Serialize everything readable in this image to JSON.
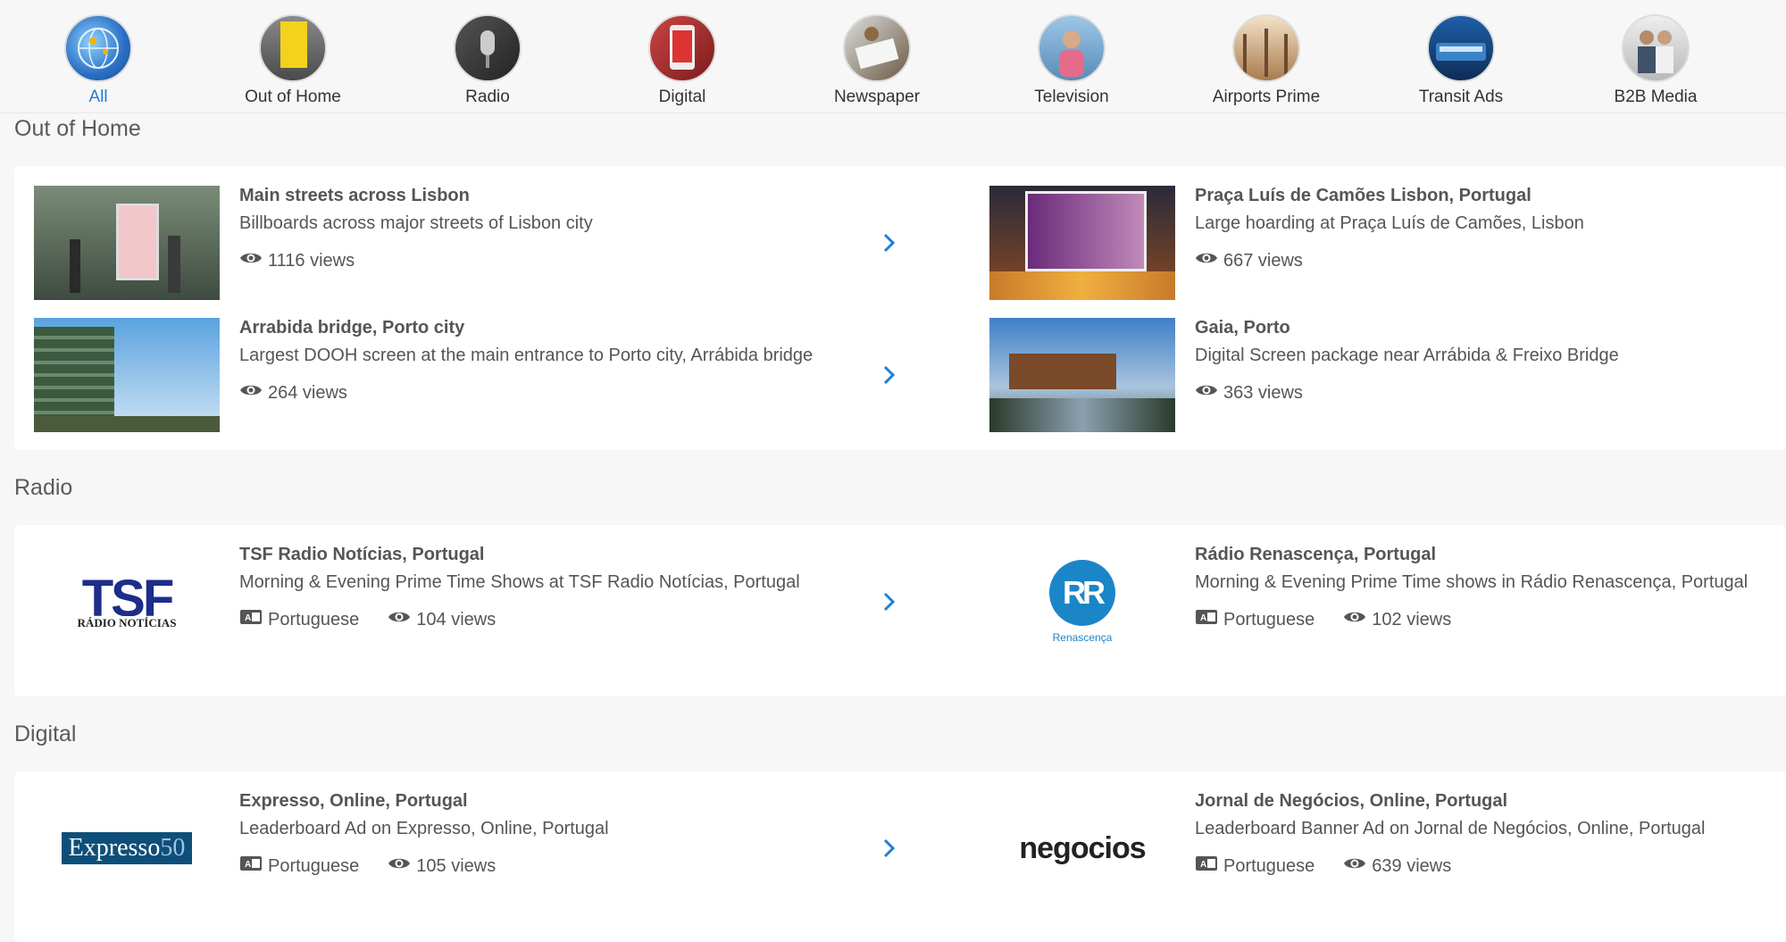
{
  "categories": [
    {
      "label": "All",
      "active": true,
      "icon": "globe-icon"
    },
    {
      "label": "Out of Home",
      "active": false,
      "icon": "billboard-icon"
    },
    {
      "label": "Radio",
      "active": false,
      "icon": "microphone-icon"
    },
    {
      "label": "Digital",
      "active": false,
      "icon": "phone-icon"
    },
    {
      "label": "Newspaper",
      "active": false,
      "icon": "newspaper-icon"
    },
    {
      "label": "Television",
      "active": false,
      "icon": "tv-icon"
    },
    {
      "label": "Airports Prime",
      "active": false,
      "icon": "airport-icon"
    },
    {
      "label": "Transit Ads",
      "active": false,
      "icon": "bus-icon"
    },
    {
      "label": "B2B Media",
      "active": false,
      "icon": "b2b-icon"
    }
  ],
  "sections": {
    "ooh": {
      "title": "Out of Home",
      "items": [
        {
          "title": "Main streets across Lisbon",
          "desc": "Billboards across major streets of Lisbon city",
          "views": "1116 views"
        },
        {
          "title": "Praça Luís de Camões Lisbon, Portugal",
          "desc": "Large hoarding at Praça Luís de Camões, Lisbon",
          "views": "667 views"
        },
        {
          "title": "Arrabida bridge, Porto city",
          "desc": "Largest DOOH screen at the main entrance to Porto city, Arrábida bridge",
          "views": "264 views"
        },
        {
          "title": "Gaia, Porto",
          "desc": "Digital Screen package near Arrábida & Freixo Bridge",
          "views": "363 views"
        }
      ]
    },
    "radio": {
      "title": "Radio",
      "items": [
        {
          "title": "TSF Radio Notícias, Portugal",
          "desc": "Morning & Evening Prime Time Shows at TSF Radio Notícias, Portugal",
          "language": "Portuguese",
          "views": "104 views",
          "logo_main": "TSF",
          "logo_sub": "RÁDIO NOTÍCIAS"
        },
        {
          "title": "Rádio Renascença, Portugal",
          "desc": "Morning & Evening Prime Time shows in Rádio Renascença, Portugal",
          "language": "Portuguese",
          "views": "102 views",
          "logo_main": "RR",
          "logo_sub": "Renascença"
        }
      ]
    },
    "digital": {
      "title": "Digital",
      "items": [
        {
          "title": "Expresso, Online, Portugal",
          "desc": "Leaderboard Ad on Expresso, Online, Portugal",
          "language": "Portuguese",
          "views": "105 views",
          "logo_main": "Expresso",
          "logo_num": "50"
        },
        {
          "title": "Jornal de Negócios, Online, Portugal",
          "desc": "Leaderboard Banner Ad on Jornal de Negócios, Online, Portugal",
          "language": "Portuguese",
          "views": "639 views",
          "logo_main": "negocios"
        }
      ]
    }
  },
  "colors": {
    "accent": "#1e7fd8",
    "text": "#555555",
    "tsf": "#1d2d8a",
    "rr": "#1a86c8",
    "expresso": "#0e4f7a"
  }
}
